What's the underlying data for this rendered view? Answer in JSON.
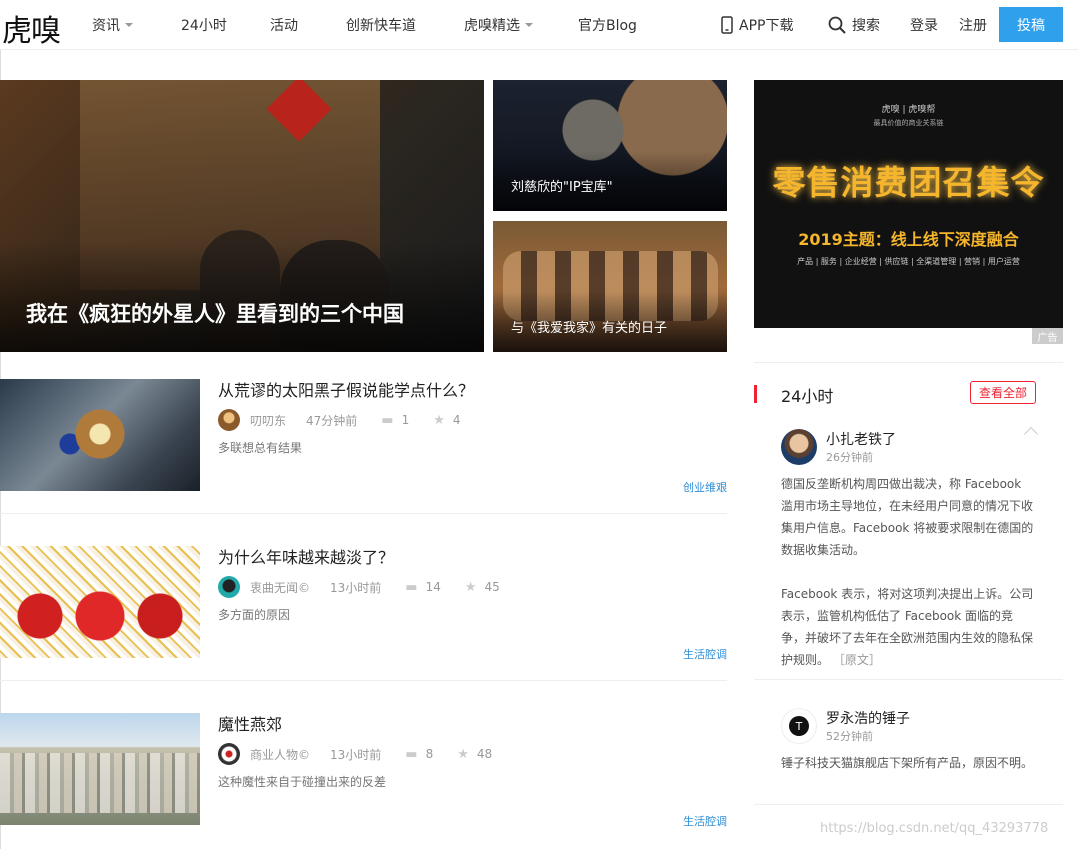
{
  "header": {
    "logo": "虎嗅",
    "nav": [
      {
        "label": "资讯",
        "dropdown": true
      },
      {
        "label": "24小时",
        "dropdown": false
      },
      {
        "label": "活动",
        "dropdown": false
      },
      {
        "label": "创新快车道",
        "dropdown": false
      },
      {
        "label": "虎嗅精选",
        "dropdown": true
      },
      {
        "label": "官方Blog",
        "dropdown": false
      }
    ],
    "app_download": "APP下载",
    "search": "搜索",
    "login": "登录",
    "register": "注册",
    "submit": "投稿"
  },
  "hero": {
    "main_title": "我在《疯狂的外星人》里看到的三个中国",
    "tile1_title": "刘慈欣的\"IP宝库\"",
    "tile2_title": "与《我爱我家》有关的日子"
  },
  "ad": {
    "top": "虎嗅 | 虎嗅帮",
    "sub": "最具价值的商业关系链",
    "headline": "零售消费团召集令",
    "theme": "2019主题：线上线下深度融合",
    "tags": "产品 | 服务 | 企业经营 | 供应链 | 全渠道管理 | 营销 | 用户运营",
    "label": "广告"
  },
  "articles": [
    {
      "title": "从荒谬的太阳黑子假说能学点什么？",
      "author": "叨叨东",
      "time": "47分钟前",
      "comments": "1",
      "favorites": "4",
      "summary": "多联想总有结果",
      "tag": "创业维艰"
    },
    {
      "title": "为什么年味越来越淡了？",
      "author": "衷曲无闻©",
      "time": "13小时前",
      "comments": "14",
      "favorites": "45",
      "summary": "多方面的原因",
      "tag": "生活腔调"
    },
    {
      "title": "魔性燕郊",
      "author": "商业人物©",
      "time": "13小时前",
      "comments": "8",
      "favorites": "48",
      "summary": "这种魔性来自于碰撞出来的反差",
      "tag": "生活腔调"
    }
  ],
  "panel": {
    "title": "24小时",
    "view_all": "查看全部",
    "feed": [
      {
        "name": "小扎老铁了",
        "time": "26分钟前",
        "text1": "德国反垄断机构周四做出裁决，称 Facebook 滥用市场主导地位，在未经用户同意的情况下收集用户信息。Facebook 将被要求限制在德国的数据收集活动。",
        "text2": "Facebook 表示，将对这项判决提出上诉。公司表示，监管机构低估了 Facebook 面临的竞争，并破坏了去年在全欧洲范围内生效的隐私保护规则。",
        "original": "［原文］"
      },
      {
        "name": "罗永浩的锤子",
        "time": "52分钟前",
        "text1": "锤子科技天猫旗舰店下架所有产品，原因不明。"
      }
    ]
  },
  "watermark": "https://blog.csdn.net/qq_43293778"
}
